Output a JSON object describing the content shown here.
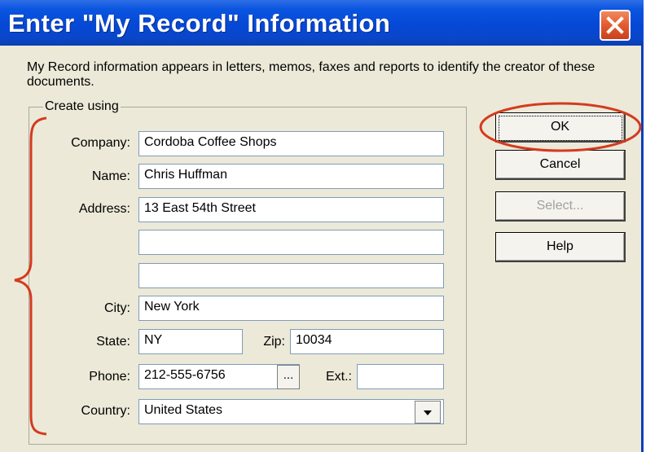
{
  "window": {
    "title": "Enter \"My Record\" Information",
    "close_icon": "close-icon"
  },
  "description": "My Record information appears in letters, memos, faxes and reports to identify the creator of these documents.",
  "group": {
    "legend": "Create using"
  },
  "fields": {
    "company": {
      "label": "Company:",
      "value": "Cordoba Coffee Shops"
    },
    "name": {
      "label": "Name:",
      "value": "Chris Huffman"
    },
    "address": {
      "label": "Address:",
      "line1": "13 East 54th Street",
      "line2": "",
      "line3": ""
    },
    "city": {
      "label": "City:",
      "value": "New York"
    },
    "state": {
      "label": "State:",
      "value": "NY"
    },
    "zip": {
      "label": "Zip:",
      "value": "10034"
    },
    "phone": {
      "label": "Phone:",
      "value": "212-555-6756",
      "lookup_label": "..."
    },
    "ext": {
      "label": "Ext.:",
      "value": ""
    },
    "country": {
      "label": "Country:",
      "value": "United States"
    }
  },
  "buttons": {
    "ok": "OK",
    "cancel": "Cancel",
    "select": "Select...",
    "help": "Help"
  },
  "colors": {
    "titlebar": "#0548d6",
    "dialog_bg": "#ece9d8",
    "annotation": "#d43a1e",
    "close": "#e35a2e"
  }
}
